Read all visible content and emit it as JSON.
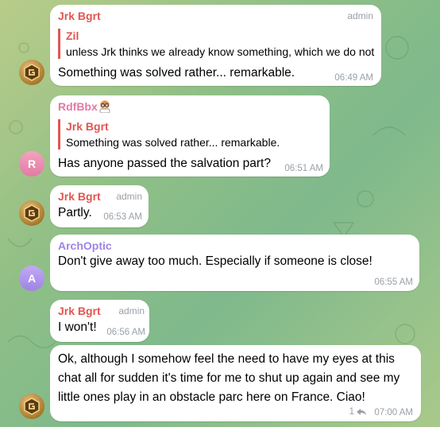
{
  "colors": {
    "jrk": "#e0564f",
    "rdf": "#e27aa4",
    "arch": "#9e84e6",
    "role": "#9aa0a6"
  },
  "messages": [
    {
      "sender": "Jrk Bgrt",
      "role": "admin",
      "reply_name": "Zil",
      "reply_text": "unless Jrk thinks we already know something, which we do not",
      "text": "Something was solved rather... remarkable.",
      "time": "06:49 AM"
    },
    {
      "sender": "RdfBbx",
      "sender_emoji": "🧑‍🔬",
      "reply_name": "Jrk Bgrt",
      "reply_text": "Something was solved rather... remarkable.",
      "text": "Has anyone passed the salvation part?",
      "time": "06:51 AM",
      "avatar_letter": "R"
    },
    {
      "sender": "Jrk Bgrt",
      "role": "admin",
      "text": "Partly.",
      "time": "06:53 AM"
    },
    {
      "sender": "ArchOptic",
      "text": "Don't give away too much. Especially if someone is close!",
      "time": "06:55 AM",
      "avatar_letter": "A"
    },
    {
      "sender": "Jrk Bgrt",
      "role": "admin",
      "text": "I won't!",
      "time": "06:56 AM"
    },
    {
      "text": "Ok, although I somehow feel the need to have my eyes at this chat all for sudden it's time for me to shut up again and see my little ones play in an obstacle parc here on France. Ciao!",
      "time": "07:00 AM",
      "reply_count": "1"
    }
  ]
}
